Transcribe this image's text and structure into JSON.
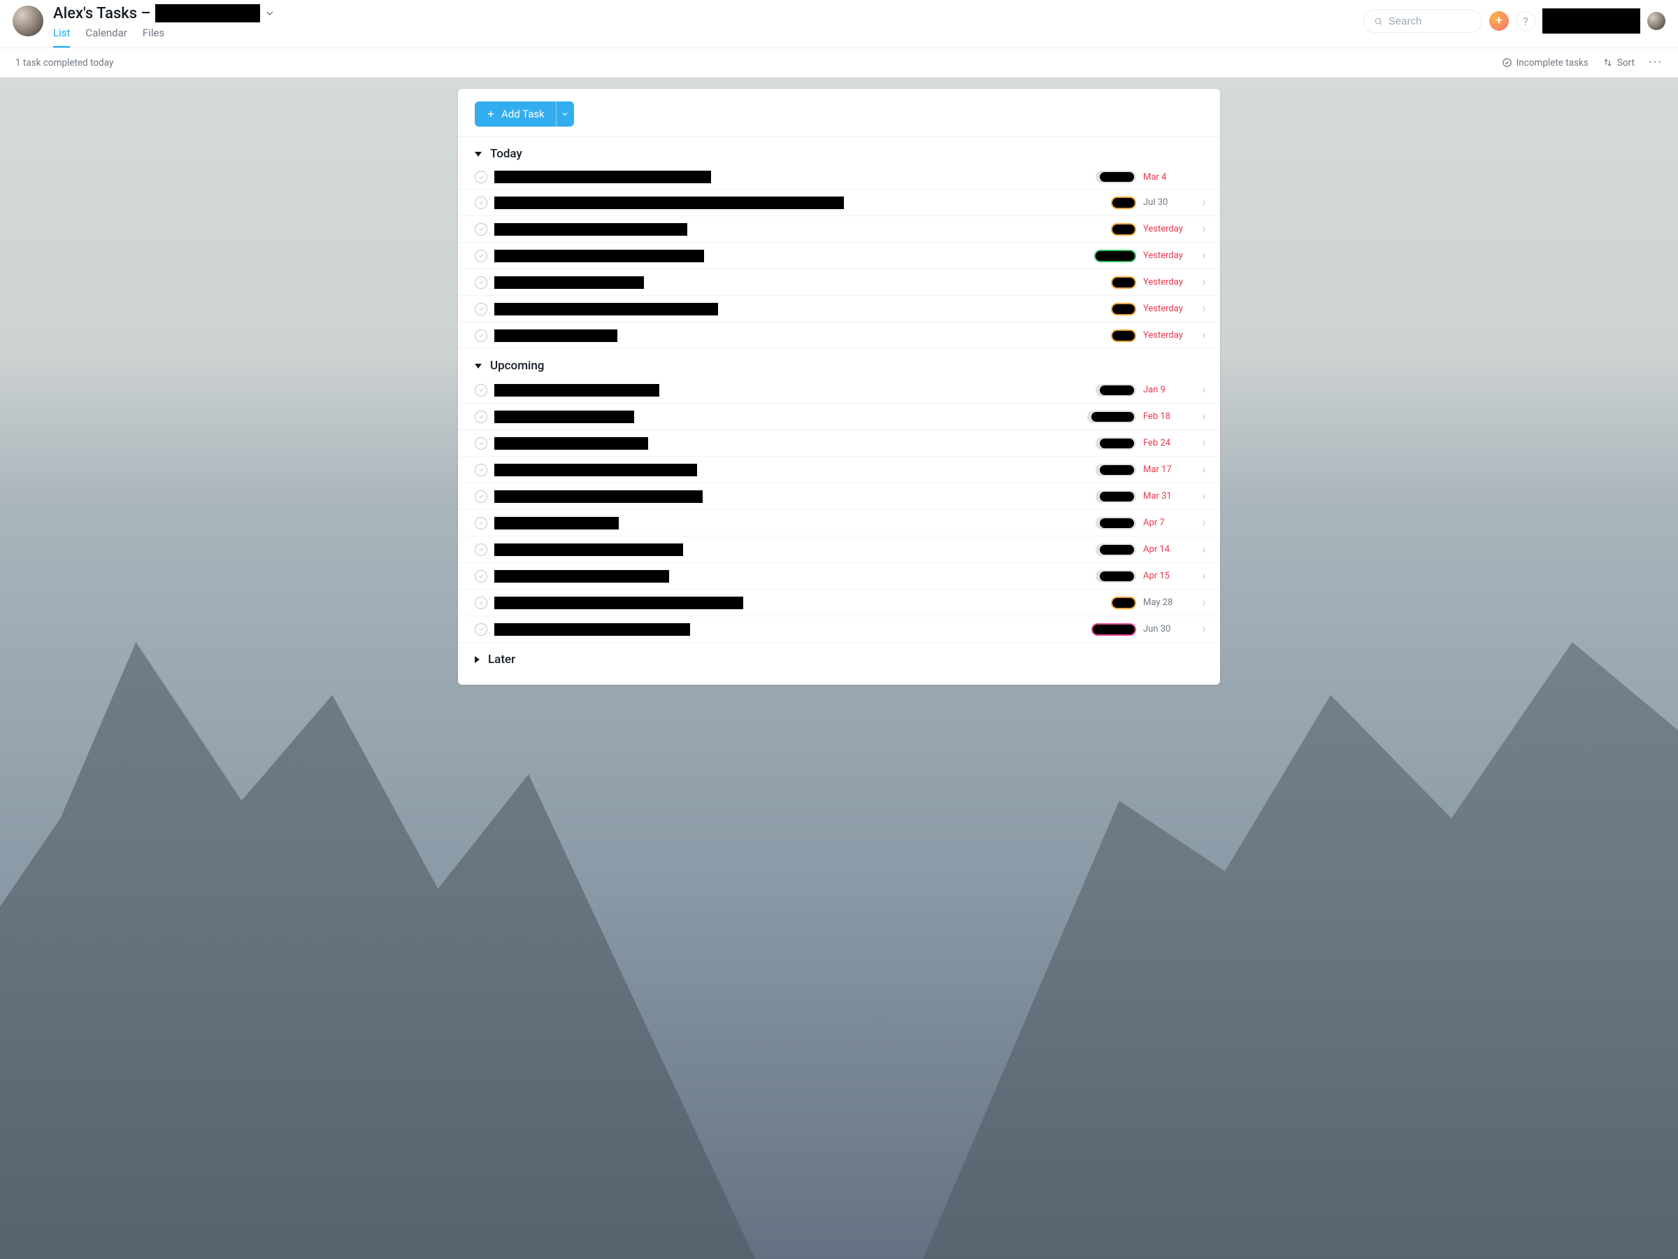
{
  "header": {
    "title_prefix": "Alex's Tasks –",
    "tabs": {
      "list": "List",
      "calendar": "Calendar",
      "files": "Files"
    },
    "search_placeholder": "Search",
    "help_label": "?"
  },
  "toolbar": {
    "status": "1 task completed today",
    "incomplete": "Incomplete tasks",
    "sort": "Sort"
  },
  "add_task_label": "Add Task",
  "sections": [
    {
      "name": "Today",
      "collapsed": false,
      "tasks": [
        {
          "name_w": 310,
          "tag_variant": "gpill",
          "tag_w": 58,
          "due": "Mar 4",
          "due_style": "red",
          "arrow": false
        },
        {
          "name_w": 500,
          "tag_variant": "orange",
          "tag_w": 36,
          "due": "Jul 30",
          "due_style": "gray",
          "arrow": true
        },
        {
          "name_w": 276,
          "tag_variant": "orange",
          "tag_w": 36,
          "due": "Yesterday",
          "due_style": "red",
          "arrow": true
        },
        {
          "name_w": 300,
          "tag_variant": "green",
          "tag_w": 60,
          "due": "Yesterday",
          "due_style": "red",
          "arrow": true
        },
        {
          "name_w": 214,
          "tag_variant": "orange",
          "tag_w": 36,
          "due": "Yesterday",
          "due_style": "red",
          "arrow": true
        },
        {
          "name_w": 320,
          "tag_variant": "orange",
          "tag_w": 36,
          "due": "Yesterday",
          "due_style": "red",
          "arrow": true
        },
        {
          "name_w": 176,
          "tag_variant": "orange",
          "tag_w": 36,
          "due": "Yesterday",
          "due_style": "red",
          "arrow": true
        }
      ]
    },
    {
      "name": "Upcoming",
      "collapsed": false,
      "tasks": [
        {
          "name_w": 236,
          "tag_variant": "gpill",
          "tag_w": 58,
          "due": "Jan 9",
          "due_style": "red",
          "arrow": true
        },
        {
          "name_w": 200,
          "tag_variant": "gpill",
          "tag_w": 70,
          "due": "Feb 18",
          "due_style": "red",
          "arrow": true
        },
        {
          "name_w": 220,
          "tag_variant": "gpill",
          "tag_w": 58,
          "due": "Feb 24",
          "due_style": "red",
          "arrow": true
        },
        {
          "name_w": 290,
          "tag_variant": "gpill",
          "tag_w": 58,
          "due": "Mar 17",
          "due_style": "red",
          "arrow": true
        },
        {
          "name_w": 298,
          "tag_variant": "gpill",
          "tag_w": 58,
          "due": "Mar 31",
          "due_style": "red",
          "arrow": true
        },
        {
          "name_w": 178,
          "tag_variant": "gpill",
          "tag_w": 58,
          "due": "Apr 7",
          "due_style": "red",
          "arrow": true
        },
        {
          "name_w": 270,
          "tag_variant": "gpill",
          "tag_w": 58,
          "due": "Apr 14",
          "due_style": "red",
          "arrow": true
        },
        {
          "name_w": 250,
          "tag_variant": "gpill",
          "tag_w": 58,
          "due": "Apr 15",
          "due_style": "red",
          "arrow": true
        },
        {
          "name_w": 356,
          "tag_variant": "orange",
          "tag_w": 36,
          "due": "May 28",
          "due_style": "gray",
          "arrow": true
        },
        {
          "name_w": 280,
          "tag_variant": "pink",
          "tag_w": 64,
          "due": "Jun 30",
          "due_style": "gray",
          "arrow": true
        }
      ]
    },
    {
      "name": "Later",
      "collapsed": true,
      "tasks": []
    }
  ]
}
